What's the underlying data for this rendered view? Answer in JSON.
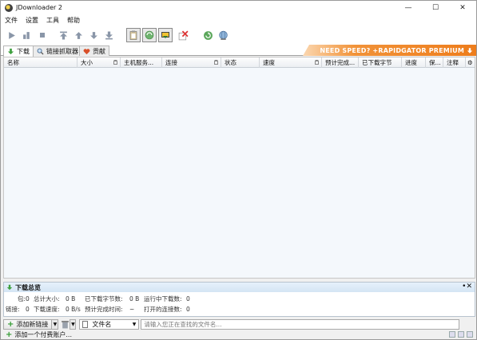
{
  "window": {
    "title": "JDownloader 2"
  },
  "menu": [
    "文件",
    "设置",
    "工具",
    "帮助"
  ],
  "tabs": [
    {
      "label": "下载",
      "icon": "download-arrow-icon",
      "active": true
    },
    {
      "label": "链接抓取器",
      "icon": "magnifier-icon",
      "active": false
    },
    {
      "label": "贡献",
      "icon": "heart-icon",
      "active": false
    }
  ],
  "promo": {
    "text": "NEED SPEED? +RAPIDGATOR PREMIUM",
    "color": "#ee7d1c"
  },
  "columns": [
    "名称",
    "大小",
    "主机服务...",
    "连接",
    "状态",
    "速度",
    "预计完成...",
    "已下载字节",
    "进度",
    "保...",
    "注释"
  ],
  "overview": {
    "title": "下载总览",
    "row1": [
      {
        "label": "包:",
        "value": "0"
      },
      {
        "label": "总计大小:",
        "value": "0 B"
      },
      {
        "label": "已下载字节数:",
        "value": "0 B"
      },
      {
        "label": "运行中下载数:",
        "value": "0"
      }
    ],
    "row2": [
      {
        "label": "链接:",
        "value": "0"
      },
      {
        "label": "下载速度:",
        "value": "0 B/s"
      },
      {
        "label": "预计完成时间:",
        "value": "~"
      },
      {
        "label": "打开的连接数:",
        "value": "0"
      }
    ]
  },
  "bottom": {
    "add_links": "添加新链接",
    "filename_select": "文件名",
    "search_placeholder": "请输入您正在查找的文件名..."
  },
  "status": {
    "add_premium": "添加一个付费账户..."
  },
  "colors": {
    "accent": "#2f9a2f",
    "promo": "#ee7d1c",
    "table_bg": "#f4f8fc"
  }
}
